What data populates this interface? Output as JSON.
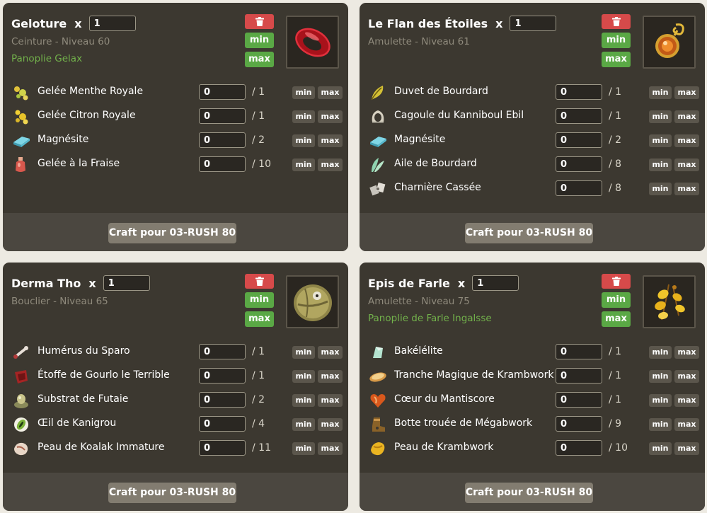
{
  "cards": [
    {
      "name": "Geloture",
      "times": "x",
      "quantity": "1",
      "meta": "Ceinture - Niveau 60",
      "set": "Panoplie Gelax",
      "delete_icon": "trash-icon",
      "min_label": "min",
      "max_label": "max",
      "resources": [
        {
          "name": "Gelée Menthe Royale",
          "value": "0",
          "total": "/ 1",
          "icon": "gelee-menthe-icon"
        },
        {
          "name": "Gelée Citron Royale",
          "value": "0",
          "total": "/ 1",
          "icon": "gelee-citron-icon"
        },
        {
          "name": "Magnésite",
          "value": "0",
          "total": "/ 2",
          "icon": "magnesite-icon"
        },
        {
          "name": "Gelée à la Fraise",
          "value": "0",
          "total": "/ 10",
          "icon": "gelee-fraise-icon"
        }
      ],
      "craft_label": "Craft pour 03-RUSH 80"
    },
    {
      "name": "Le Flan des Étoiles",
      "times": "x",
      "quantity": "1",
      "meta": "Amulette - Niveau 61",
      "set": "",
      "delete_icon": "trash-icon",
      "min_label": "min",
      "max_label": "max",
      "resources": [
        {
          "name": "Duvet de Bourdard",
          "value": "0",
          "total": "/ 1",
          "icon": "feather-icon"
        },
        {
          "name": "Cagoule du Kanniboul Ebil",
          "value": "0",
          "total": "/ 1",
          "icon": "hood-icon"
        },
        {
          "name": "Magnésite",
          "value": "0",
          "total": "/ 2",
          "icon": "magnesite-icon"
        },
        {
          "name": "Aile de Bourdard",
          "value": "0",
          "total": "/ 8",
          "icon": "wing-icon"
        },
        {
          "name": "Charnière Cassée",
          "value": "0",
          "total": "/ 8",
          "icon": "hinge-icon"
        }
      ],
      "craft_label": "Craft pour 03-RUSH 80"
    },
    {
      "name": "Derma Tho",
      "times": "x",
      "quantity": "1",
      "meta": "Bouclier - Niveau 65",
      "set": "",
      "delete_icon": "trash-icon",
      "min_label": "min",
      "max_label": "max",
      "resources": [
        {
          "name": "Humérus du Sparo",
          "value": "0",
          "total": "/ 1",
          "icon": "bone-icon"
        },
        {
          "name": "Étoffe de Gourlo le Terrible",
          "value": "0",
          "total": "/ 1",
          "icon": "cloth-icon"
        },
        {
          "name": "Substrat de Futaie",
          "value": "0",
          "total": "/ 2",
          "icon": "substrate-icon"
        },
        {
          "name": "Œil de Kanigrou",
          "value": "0",
          "total": "/ 4",
          "icon": "eye-icon"
        },
        {
          "name": "Peau de Koalak Immature",
          "value": "0",
          "total": "/ 11",
          "icon": "skin-icon"
        }
      ],
      "craft_label": "Craft pour 03-RUSH 80"
    },
    {
      "name": "Epis de Farle",
      "times": "x",
      "quantity": "1",
      "meta": "Amulette - Niveau 75",
      "set": "Panoplie de Farle Ingalsse",
      "delete_icon": "trash-icon",
      "min_label": "min",
      "max_label": "max",
      "resources": [
        {
          "name": "Bakélélite",
          "value": "0",
          "total": "/ 1",
          "icon": "bakelite-icon"
        },
        {
          "name": "Tranche Magique de Krambwork",
          "value": "0",
          "total": "/ 1",
          "icon": "bread-slice-icon"
        },
        {
          "name": "Cœur du Mantiscore",
          "value": "0",
          "total": "/ 1",
          "icon": "heart-icon"
        },
        {
          "name": "Botte trouée de Mégabwork",
          "value": "0",
          "total": "/ 9",
          "icon": "boot-icon"
        },
        {
          "name": "Peau de Krambwork",
          "value": "0",
          "total": "/ 10",
          "icon": "pelt-icon"
        }
      ],
      "craft_label": "Craft pour 03-RUSH 80"
    }
  ]
}
